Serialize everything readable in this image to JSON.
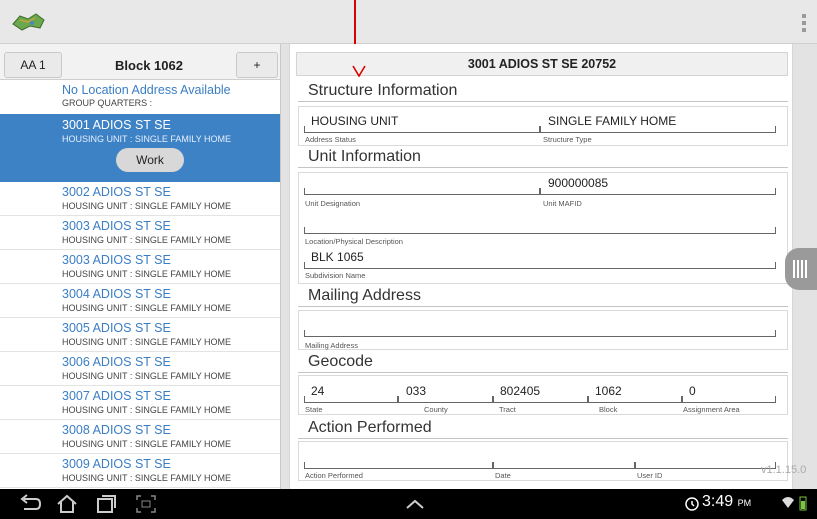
{
  "block": {
    "aa_label": "AA 1",
    "title": "Block 1062",
    "add_label": "+"
  },
  "no_location": {
    "title": "No Location Address Available",
    "subtitle": "GROUP QUARTERS :"
  },
  "selected": {
    "address": "3001 ADIOS ST SE",
    "type": "HOUSING UNIT : SINGLE FAMILY HOME",
    "work_label": "Work"
  },
  "list": [
    {
      "address": "3002 ADIOS ST SE",
      "type": "HOUSING UNIT : SINGLE FAMILY HOME"
    },
    {
      "address": "3003 ADIOS ST SE",
      "type": "HOUSING UNIT : SINGLE FAMILY HOME"
    },
    {
      "address": "3003 ADIOS ST SE",
      "type": "HOUSING UNIT : SINGLE FAMILY HOME"
    },
    {
      "address": "3004 ADIOS ST SE",
      "type": "HOUSING UNIT : SINGLE FAMILY HOME"
    },
    {
      "address": "3005 ADIOS ST SE",
      "type": "HOUSING UNIT : SINGLE FAMILY HOME"
    },
    {
      "address": "3006 ADIOS ST SE",
      "type": "HOUSING UNIT : SINGLE FAMILY HOME"
    },
    {
      "address": "3007 ADIOS ST SE",
      "type": "HOUSING UNIT : SINGLE FAMILY HOME"
    },
    {
      "address": "3008 ADIOS ST SE",
      "type": "HOUSING UNIT : SINGLE FAMILY HOME"
    },
    {
      "address": "3009 ADIOS ST SE",
      "type": "HOUSING UNIT : SINGLE FAMILY HOME"
    }
  ],
  "detail": {
    "header": "3001 ADIOS ST SE 20752",
    "structure": {
      "title": "Structure Information",
      "address_status": {
        "value": "HOUSING UNIT",
        "label": "Address Status"
      },
      "structure_type": {
        "value": "SINGLE FAMILY HOME",
        "label": "Structure Type"
      }
    },
    "unit": {
      "title": "Unit Information",
      "unit_designation": {
        "value": "",
        "label": "Unit Designation"
      },
      "unit_mafid": {
        "value": "900000085",
        "label": "Unit MAFID"
      },
      "location_desc": {
        "value": "",
        "label": "Location/Physical Description"
      },
      "subdivision": {
        "value": "BLK 1065",
        "label": "Subdivision Name"
      }
    },
    "mailing": {
      "title": "Mailing Address",
      "mailing_address": {
        "value": "",
        "label": "Mailing Address"
      }
    },
    "geocode": {
      "title": "Geocode",
      "state": {
        "value": "24",
        "label": "State"
      },
      "county": {
        "value": "033",
        "label": "County"
      },
      "tract": {
        "value": "802405",
        "label": "Tract"
      },
      "block": {
        "value": "1062",
        "label": "Block"
      },
      "assignment_area": {
        "value": "0",
        "label": "Assignment Area"
      }
    },
    "action": {
      "title": "Action Performed",
      "action_performed": {
        "value": "",
        "label": "Action Performed"
      },
      "date": {
        "value": "",
        "label": "Date"
      },
      "user_id": {
        "value": "",
        "label": "User ID"
      }
    },
    "version": "v1.1.15.0"
  },
  "statusbar": {
    "time": "3:49",
    "ampm": "PM"
  },
  "icons": {
    "app": "map-app-icon",
    "overflow": "overflow-menu-icon",
    "back": "back-icon",
    "home": "home-icon",
    "recents": "recent-apps-icon",
    "screenshot": "screenshot-icon",
    "up": "chevron-up-icon",
    "clock": "alarm-icon",
    "wifi": "wifi-icon",
    "battery": "battery-icon"
  },
  "colors": {
    "accent": "#3d82c4",
    "annotation": "#d90000"
  }
}
